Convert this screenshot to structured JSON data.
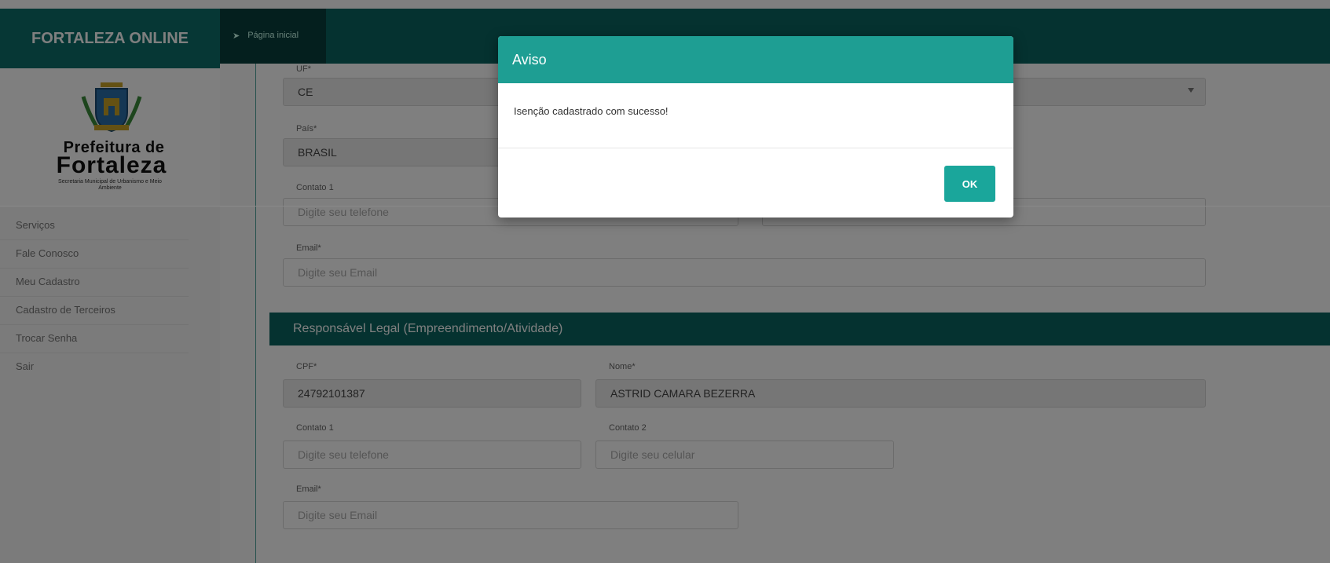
{
  "app": {
    "brand": "FORTALEZA ONLINE",
    "breadcrumb": "Página inicial"
  },
  "logo": {
    "line1": "Prefeitura de",
    "line2": "Fortaleza",
    "sub": "Secretaria Municipal de Urbanismo e Meio Ambiente"
  },
  "sidebar": {
    "items": [
      {
        "label": "Serviços"
      },
      {
        "label": "Fale Conosco"
      },
      {
        "label": "Meu Cadastro"
      },
      {
        "label": "Cadastro de Terceiros"
      },
      {
        "label": "Trocar Senha"
      },
      {
        "label": "Sair"
      }
    ]
  },
  "form": {
    "uf": {
      "label": "UF*",
      "value": "CE"
    },
    "pais": {
      "label": "País*",
      "value": "BRASIL"
    },
    "contato1": {
      "label": "Contato 1",
      "placeholder": "Digite seu telefone"
    },
    "email": {
      "label": "Email*",
      "placeholder": "Digite seu Email"
    }
  },
  "responsavel": {
    "title": "Responsável Legal (Empreendimento/Atividade)",
    "cpf": {
      "label": "CPF*",
      "value": "24792101387"
    },
    "nome": {
      "label": "Nome*",
      "value": "ASTRID CAMARA BEZERRA"
    },
    "contato1": {
      "label": "Contato 1",
      "placeholder": "Digite seu telefone"
    },
    "contato2": {
      "label": "Contato 2",
      "placeholder": "Digite seu celular"
    },
    "email": {
      "label": "Email*",
      "placeholder": "Digite seu Email"
    }
  },
  "modal": {
    "title": "Aviso",
    "message": "Isenção cadastrado com sucesso!",
    "ok_label": "OK"
  },
  "colors": {
    "primary": "#0a6561",
    "modal_header": "#1e9e93",
    "button": "#1aa69b"
  }
}
